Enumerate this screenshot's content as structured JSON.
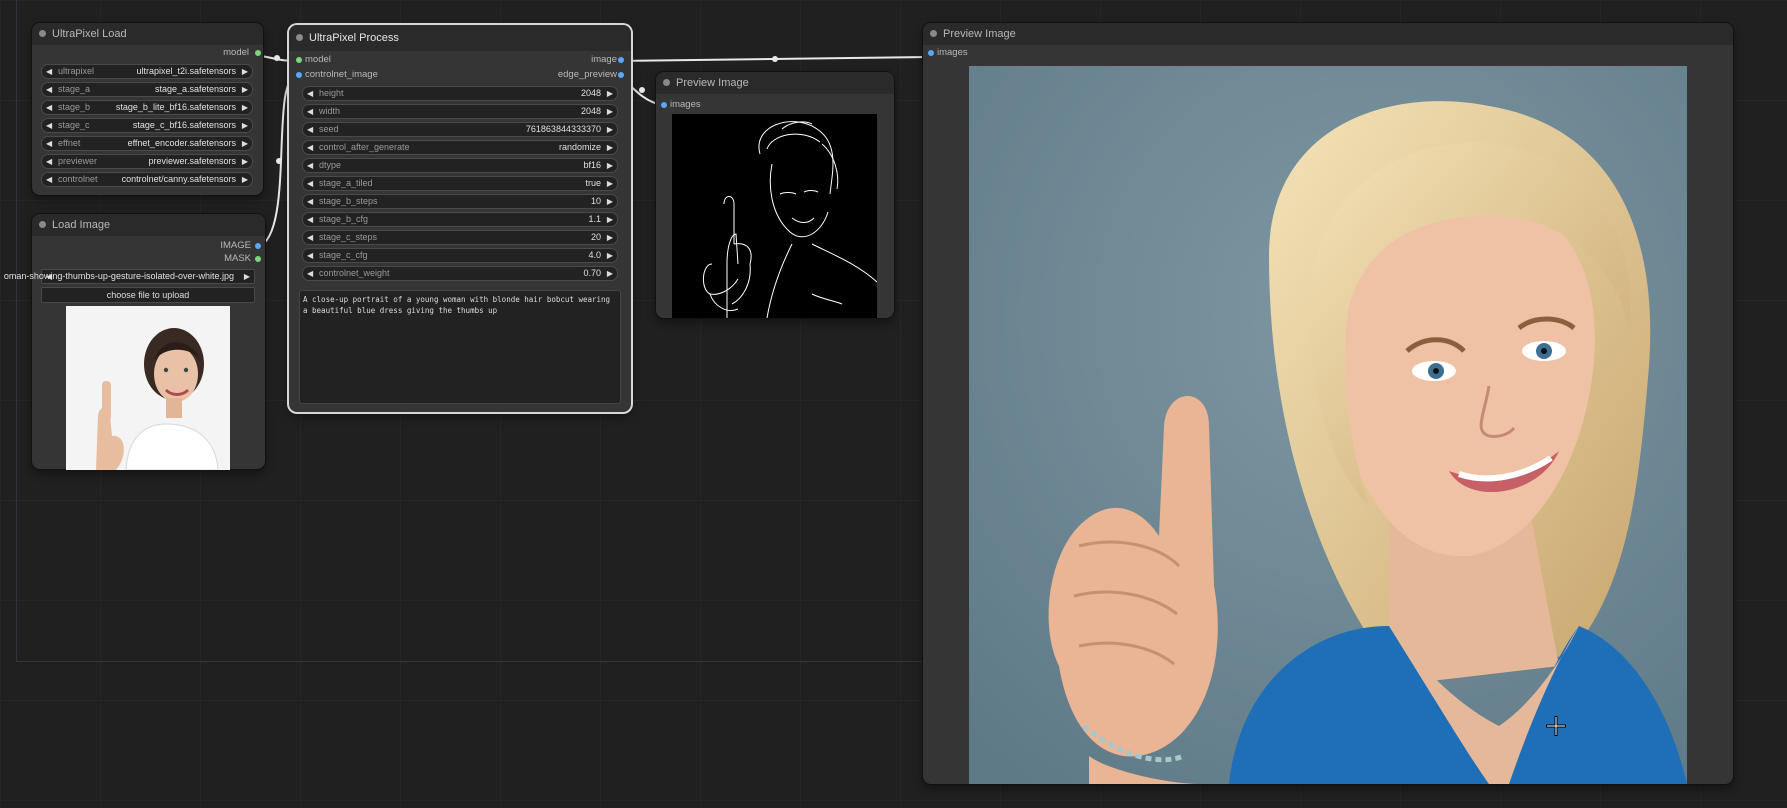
{
  "colors": {
    "canvas": "#202020",
    "node": "#353535",
    "link": "#e8e8e8",
    "slot_model": "#7dd57d",
    "slot_image": "#59a8ff"
  },
  "nodes": {
    "ultrapixel_load": {
      "title": "UltraPixel Load",
      "output_label": "model",
      "widgets": [
        {
          "name": "ultrapixel",
          "value": "ultrapixel_t2i.safetensors"
        },
        {
          "name": "stage_a",
          "value": "stage_a.safetensors"
        },
        {
          "name": "stage_b",
          "value": "stage_b_lite_bf16.safetensors"
        },
        {
          "name": "stage_c",
          "value": "stage_c_bf16.safetensors"
        },
        {
          "name": "effnet",
          "value": "effnet_encoder.safetensors"
        },
        {
          "name": "previewer",
          "value": "previewer.safetensors"
        },
        {
          "name": "controlnet",
          "value": "controlnet/canny.safetensors"
        }
      ]
    },
    "load_image": {
      "title": "Load Image",
      "outputs": [
        "IMAGE",
        "MASK"
      ],
      "image_value": "oman-showing-thumbs-up-gesture-isolated-over-white.jpg",
      "upload_label": "choose file to upload",
      "thumbnail": "woman-thumbs-up-photo"
    },
    "ultrapixel_process": {
      "title": "UltraPixel Process",
      "inputs": [
        "model",
        "controlnet_image"
      ],
      "outputs": [
        "image",
        "edge_preview"
      ],
      "widgets": [
        {
          "name": "height",
          "value": "2048"
        },
        {
          "name": "width",
          "value": "2048"
        },
        {
          "name": "seed",
          "value": "761863844333370"
        },
        {
          "name": "control_after_generate",
          "value": "randomize"
        },
        {
          "name": "dtype",
          "value": "bf16"
        },
        {
          "name": "stage_a_tiled",
          "value": "true"
        },
        {
          "name": "stage_b_steps",
          "value": "10"
        },
        {
          "name": "stage_b_cfg",
          "value": "1.1"
        },
        {
          "name": "stage_c_steps",
          "value": "20"
        },
        {
          "name": "stage_c_cfg",
          "value": "4.0"
        },
        {
          "name": "controlnet_weight",
          "value": "0.70"
        }
      ],
      "prompt": "A close-up portrait of a young woman with blonde hair bobcut wearing a beautiful blue dress giving the thumbs up"
    },
    "preview_small": {
      "title": "Preview Image",
      "input_label": "images",
      "image": "edge-sketch"
    },
    "preview_large": {
      "title": "Preview Image",
      "input_label": "images",
      "image": "blonde-woman-thumbs-up"
    }
  },
  "cursor": "crosshair-icon"
}
